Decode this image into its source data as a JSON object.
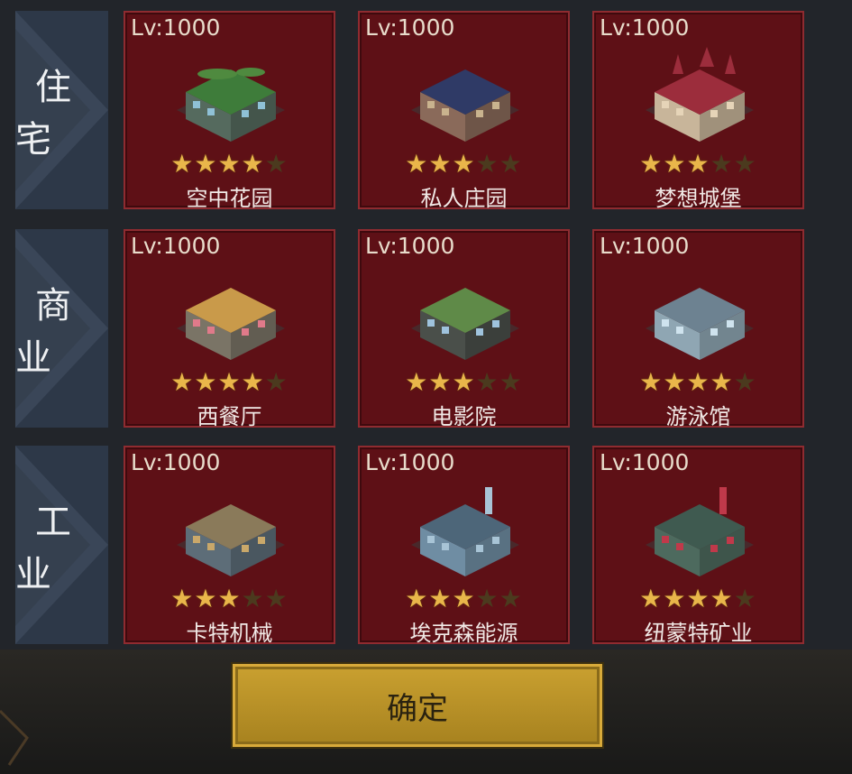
{
  "rows": [
    {
      "category": "住宅",
      "items": [
        {
          "level": "Lv:1000",
          "stars": 4,
          "name": "空中花园",
          "icon": "sky-garden-building-icon",
          "colors": {
            "body": "#556a5e",
            "roof": "#3e7c3a",
            "accent": "#8fc1d6"
          }
        },
        {
          "level": "Lv:1000",
          "stars": 3,
          "name": "私人庄园",
          "icon": "private-manor-building-icon",
          "colors": {
            "body": "#8a6a5a",
            "roof": "#2f3a66",
            "accent": "#c9b38e"
          }
        },
        {
          "level": "Lv:1000",
          "stars": 3,
          "name": "梦想城堡",
          "icon": "dream-castle-building-icon",
          "colors": {
            "body": "#c8b59a",
            "roof": "#9c2d3c",
            "accent": "#e6d4b8"
          }
        }
      ]
    },
    {
      "category": "商业",
      "items": [
        {
          "level": "Lv:1000",
          "stars": 4,
          "name": "西餐厅",
          "icon": "restaurant-building-icon",
          "colors": {
            "body": "#7a7466",
            "roof": "#c99a4a",
            "accent": "#e07a8a"
          }
        },
        {
          "level": "Lv:1000",
          "stars": 3,
          "name": "电影院",
          "icon": "cinema-building-icon",
          "colors": {
            "body": "#4a4f4a",
            "roof": "#5f8a48",
            "accent": "#9fc3dd"
          }
        },
        {
          "level": "Lv:1000",
          "stars": 4,
          "name": "游泳馆",
          "icon": "swimming-hall-building-icon",
          "colors": {
            "body": "#8fa6b3",
            "roof": "#6d8291",
            "accent": "#cfe3ee"
          }
        }
      ]
    },
    {
      "category": "工业",
      "items": [
        {
          "level": "Lv:1000",
          "stars": 3,
          "name": "卡特机械",
          "icon": "machinery-factory-building-icon",
          "colors": {
            "body": "#5d6d78",
            "roof": "#8a7a5a",
            "accent": "#c9a86a"
          }
        },
        {
          "level": "Lv:1000",
          "stars": 3,
          "name": "埃克森能源",
          "icon": "energy-plant-building-icon",
          "colors": {
            "body": "#6f8da3",
            "roof": "#4d6679",
            "accent": "#a8c4d6"
          }
        },
        {
          "level": "Lv:1000",
          "stars": 4,
          "name": "纽蒙特矿业",
          "icon": "mining-facility-building-icon",
          "colors": {
            "body": "#4d6a5e",
            "roof": "#3f5a50",
            "accent": "#c0394a"
          }
        }
      ]
    }
  ],
  "max_stars": 5,
  "confirm_label": "确定",
  "theme": {
    "card_bg": "#5e1016",
    "card_border": "#8f2b30",
    "star": "#e9b64a",
    "button": "#c9a030"
  }
}
